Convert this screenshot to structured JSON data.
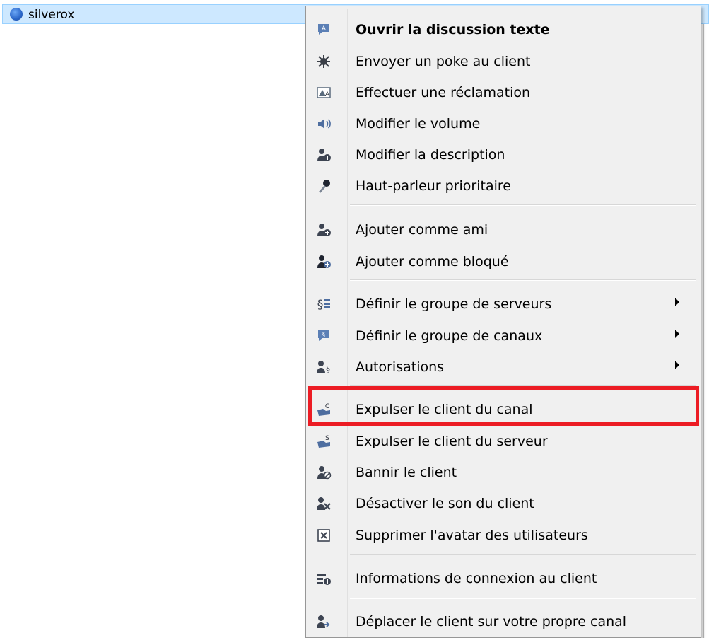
{
  "tree": {
    "user": "silverox"
  },
  "menu": {
    "items": [
      {
        "label": "Ouvrir la discussion texte",
        "icon": "chat-bubble-icon",
        "glyph": "💬",
        "bold": true,
        "submenu": false
      },
      {
        "label": "Envoyer un poke au client",
        "icon": "poke-icon",
        "glyph": "✸",
        "bold": false,
        "submenu": false
      },
      {
        "label": "Effectuer une réclamation",
        "icon": "complaint-icon",
        "glyph": "⚠",
        "bold": false,
        "submenu": false
      },
      {
        "label": "Modifier le volume",
        "icon": "volume-icon",
        "glyph": "🔊",
        "bold": false,
        "submenu": false
      },
      {
        "label": "Modifier la description",
        "icon": "user-description-icon",
        "glyph": "👤",
        "bold": false,
        "submenu": false
      },
      {
        "label": "Haut-parleur prioritaire",
        "icon": "microphone-icon",
        "glyph": "🎤",
        "bold": false,
        "submenu": false
      },
      {
        "label": "Ajouter comme ami",
        "icon": "add-friend-icon",
        "glyph": "👤",
        "bold": false,
        "submenu": false
      },
      {
        "label": "Ajouter comme bloqué",
        "icon": "add-blocked-icon",
        "glyph": "👤",
        "bold": false,
        "submenu": false
      },
      {
        "label": "Définir le groupe de serveurs",
        "icon": "server-group-icon",
        "glyph": "§",
        "bold": false,
        "submenu": true
      },
      {
        "label": "Définir le groupe de canaux",
        "icon": "channel-group-icon",
        "glyph": "§",
        "bold": false,
        "submenu": true
      },
      {
        "label": "Autorisations",
        "icon": "permissions-icon",
        "glyph": "§",
        "bold": false,
        "submenu": true
      },
      {
        "label": "Expulser le client du canal",
        "icon": "kick-channel-icon",
        "glyph": "👢",
        "bold": false,
        "submenu": false
      },
      {
        "label": "Expulser le client du serveur",
        "icon": "kick-server-icon",
        "glyph": "👢",
        "bold": false,
        "submenu": false
      },
      {
        "label": "Bannir le client",
        "icon": "ban-icon",
        "glyph": "⊘",
        "bold": false,
        "submenu": false
      },
      {
        "label": "Désactiver le son du client",
        "icon": "mute-client-icon",
        "glyph": "✕",
        "bold": false,
        "submenu": false
      },
      {
        "label": "Supprimer l'avatar des utilisateurs",
        "icon": "delete-avatar-icon",
        "glyph": "☒",
        "bold": false,
        "submenu": false
      },
      {
        "label": "Informations de connexion au client",
        "icon": "connection-info-icon",
        "glyph": "ℹ",
        "bold": false,
        "submenu": false
      },
      {
        "label": "Déplacer le client sur votre propre canal",
        "icon": "move-client-icon",
        "glyph": "➜",
        "bold": false,
        "submenu": false
      }
    ]
  },
  "colors": {
    "highlight": "#ec1c24",
    "selection": "#cde8ff"
  }
}
